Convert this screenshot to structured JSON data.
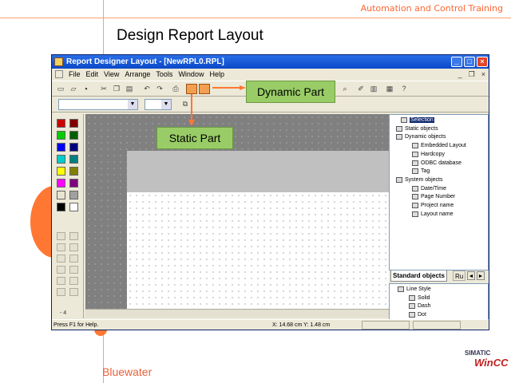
{
  "slide": {
    "header_brand": "Automation and Control Training",
    "title": "Design Report Layout",
    "footer_brand": "Bluewater",
    "logo_top": "SIMATIC",
    "logo_main": "WinCC"
  },
  "window": {
    "title": "Report Designer Layout - [NewRPL0.RPL]",
    "menu": [
      "File",
      "Edit",
      "View",
      "Arrange",
      "Tools",
      "Window",
      "Help"
    ],
    "status_help": "Press F1 for Help.",
    "status_coords": "X: 14.68 cm Y: 1.48 cm",
    "zoom_label": "- 4"
  },
  "callouts": {
    "dynamic": "Dynamic Part",
    "static": "Static Part"
  },
  "colors": {
    "accent": "#ff7733",
    "callout": "#99cc66",
    "swatches": [
      "#cc0000",
      "#800000",
      "#00cc00",
      "#006000",
      "#0000ff",
      "#000080",
      "#00cccc",
      "#008080",
      "#ffff00",
      "#808000",
      "#ff00ff",
      "#800080",
      "#e8e4d0",
      "#a0a0a0",
      "#000000",
      "#ffffff"
    ]
  },
  "tree": {
    "items": [
      "Selection",
      "Static objects",
      "Dynamic objects",
      "Embedded Layout",
      "Hardcopy",
      "ODBC database",
      "Tag",
      "System objects",
      "Date/Time",
      "Page Number",
      "Project name",
      "Layout name"
    ],
    "tab_standard": "Standard objects",
    "tab_ru": "Ru"
  },
  "styles": {
    "items": [
      "Line Style",
      "Solid",
      "Dash",
      "Dot"
    ]
  }
}
